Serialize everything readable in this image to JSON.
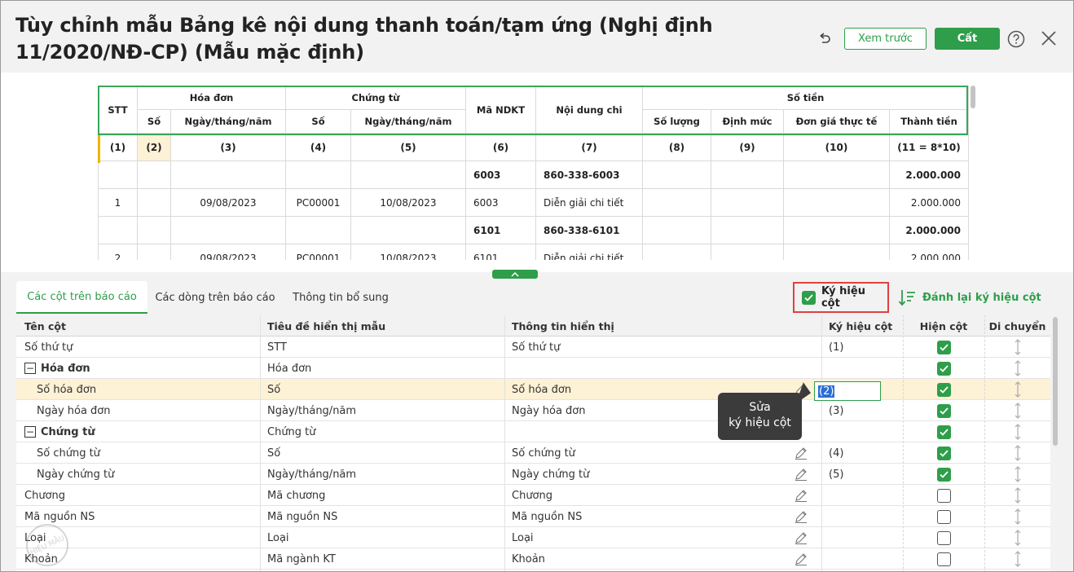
{
  "window": {
    "title": "Tùy chỉnh mẫu Bảng kê nội dung thanh toán/tạm ứng (Nghị định 11/2020/NĐ-CP) (Mẫu mặc định)",
    "preview_label": "Xem trước",
    "save_label": "Cất"
  },
  "report": {
    "header1": [
      "STT",
      "Hóa đơn",
      "Chứng từ",
      "Mã NDKT",
      "Nội dung chi",
      "Số tiền"
    ],
    "header2": [
      "Số",
      "Ngày/tháng/năm",
      "Số",
      "Ngày/tháng/năm",
      "Số lượng",
      "Định mức",
      "Đơn giá thực tế",
      "Thành tiền"
    ],
    "numbers": [
      "(1)",
      "(2)",
      "(3)",
      "(4)",
      "(5)",
      "(6)",
      "(7)",
      "(8)",
      "(9)",
      "(10)",
      "(11 = 8*10)"
    ],
    "rows": [
      [
        "",
        "",
        "",
        "",
        "",
        "6003",
        "860-338-6003",
        "",
        "",
        "",
        "2.000.000"
      ],
      [
        "1",
        "",
        "09/08/2023",
        "PC00001",
        "10/08/2023",
        "6003",
        "Diễn giải chi tiết",
        "",
        "",
        "",
        "2.000.000"
      ],
      [
        "",
        "",
        "",
        "",
        "",
        "6101",
        "860-338-6101",
        "",
        "",
        "",
        "2.000.000"
      ],
      [
        "2",
        "",
        "09/08/2023",
        "PC00001",
        "10/08/2023",
        "6101",
        "Diễn giải chi tiết",
        "",
        "",
        "",
        "2.000.000"
      ]
    ]
  },
  "tabs": [
    "Các cột trên báo cáo",
    "Các dòng trên báo cáo",
    "Thông tin bổ sung"
  ],
  "options": {
    "symbol_toggle": "Ký hiệu cột",
    "renumber": "Đánh lại ký hiệu cột"
  },
  "grid": {
    "headers": [
      "Tên cột",
      "Tiêu đề hiển thị mẫu",
      "Thông tin hiển thị",
      "Ký hiệu cột",
      "Hiện cột",
      "Di chuyển"
    ],
    "rows": [
      {
        "name": "Số thứ tự",
        "title": "STT",
        "info": "Số thứ tự",
        "symbol": "(1)",
        "visible": true
      },
      {
        "name": "Hóa đơn",
        "title": "Hóa đơn",
        "info": "",
        "symbol": "",
        "visible": true
      },
      {
        "name": "Số hóa đơn",
        "title": "Số",
        "info": "Số hóa đơn",
        "symbol": "(2)",
        "visible": true
      },
      {
        "name": "Ngày hóa đơn",
        "title": "Ngày/tháng/năm",
        "info": "Ngày hóa đơn",
        "symbol": "(3)",
        "visible": true
      },
      {
        "name": "Chứng từ",
        "title": "Chứng từ",
        "info": "",
        "symbol": "",
        "visible": true
      },
      {
        "name": "Số chứng từ",
        "title": "Số",
        "info": "Số chứng từ",
        "symbol": "(4)",
        "visible": true
      },
      {
        "name": "Ngày chứng từ",
        "title": "Ngày/tháng/năm",
        "info": "Ngày chứng từ",
        "symbol": "(5)",
        "visible": true
      },
      {
        "name": "Chương",
        "title": "Mã chương",
        "info": "Chương",
        "symbol": "",
        "visible": false
      },
      {
        "name": "Mã nguồn NS",
        "title": "Mã nguồn NS",
        "info": "Mã nguồn NS",
        "symbol": "",
        "visible": false
      },
      {
        "name": "Loại",
        "title": "Loại",
        "info": "Loại",
        "symbol": "",
        "visible": false
      },
      {
        "name": "Khoản",
        "title": "Mã ngành KT",
        "info": "Khoản",
        "symbol": "",
        "visible": false
      }
    ]
  },
  "tooltip": {
    "line1": "Sửa",
    "line2": "ký hiệu cột"
  },
  "watermark": "HIỆU MẪU"
}
